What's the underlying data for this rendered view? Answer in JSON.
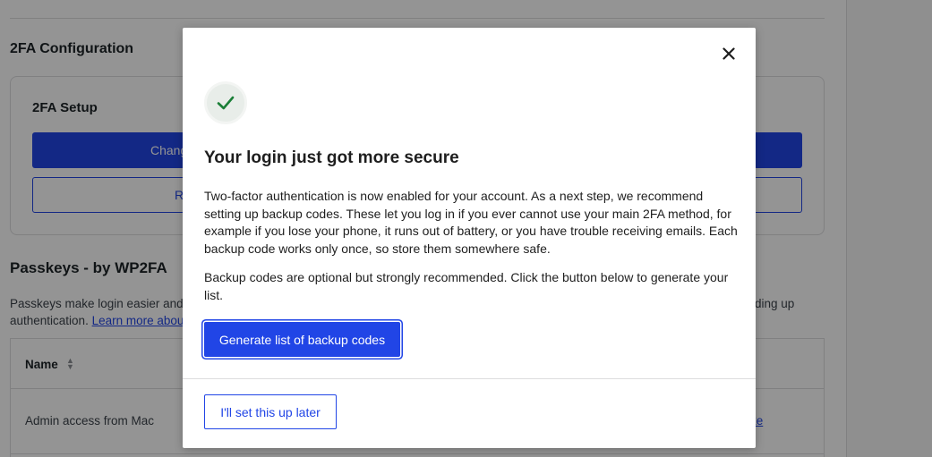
{
  "background": {
    "section_title": "2FA Configuration",
    "setup_title": "2FA Setup",
    "primary_button": "Chang",
    "secondary_button": "R",
    "passkeys_title": "Passkeys - by WP2FA",
    "passkeys_desc_line1": "Passkeys make login easier and",
    "passkeys_desc_line1_right": "ding up",
    "passkeys_desc_line2": "authentication.",
    "learn_more": "Learn more abou",
    "table": {
      "header_name": "Name",
      "rows": [
        {
          "name": "Admin access from Mac",
          "action": "ke"
        }
      ]
    }
  },
  "modal": {
    "title": "Your login just got more secure",
    "body_paragraph_1": "Two-factor authentication is now enabled for your account. As a next step, we recommend setting up backup codes. These let you log in if you ever cannot use your main 2FA method, for example if you lose your phone, it runs out of battery, or you have trouble receiving emails. Each backup code works only once, so store them somewhere safe.",
    "body_paragraph_2": "Backup codes are optional but strongly recommended. Click the button below to generate your list.",
    "generate_button": "Generate list of backup codes",
    "later_button": "I'll set this up later",
    "close_icon": "close-icon",
    "success_icon": "checkmark-icon"
  },
  "colors": {
    "accent": "#2145e6",
    "success": "#1a7f37",
    "overlay": "rgba(0,0,0,0.42)"
  }
}
